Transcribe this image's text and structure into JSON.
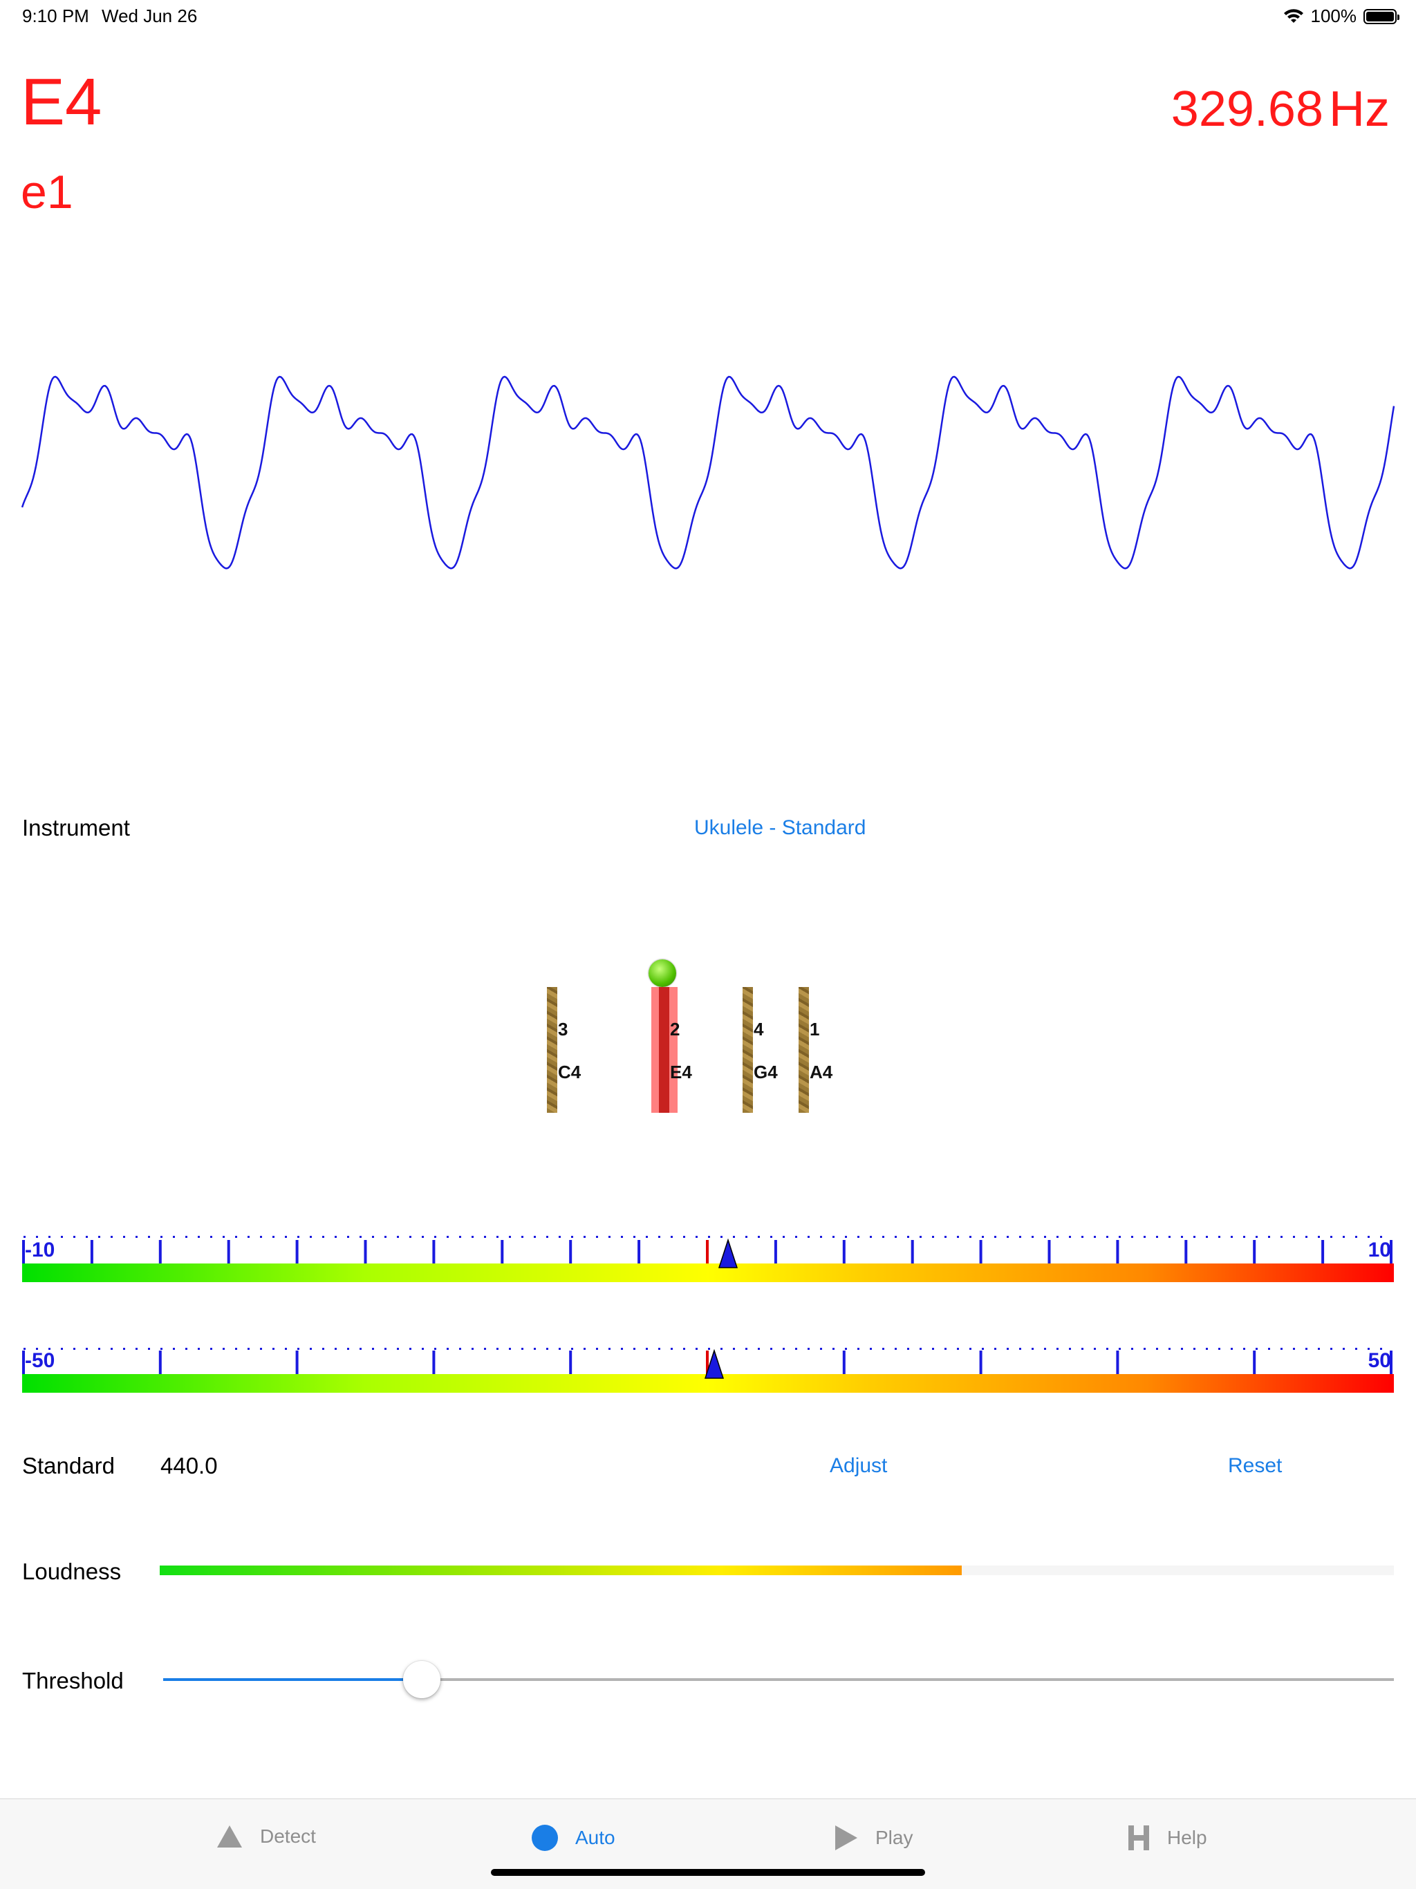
{
  "status_bar": {
    "time": "9:10 PM",
    "date": "Wed Jun 26",
    "battery": "100%"
  },
  "note": {
    "name": "E4",
    "alt_name": "e1"
  },
  "frequency": {
    "value": "329.68",
    "unit": "Hz"
  },
  "instrument": {
    "label": "Instrument",
    "value": "Ukulele - Standard"
  },
  "strings": [
    {
      "number": "3",
      "note": "C4",
      "active": false
    },
    {
      "number": "2",
      "note": "E4",
      "active": true
    },
    {
      "number": "4",
      "note": "G4",
      "active": false
    },
    {
      "number": "1",
      "note": "A4",
      "active": false
    }
  ],
  "fine_meter": {
    "min_label": "-10",
    "max_label": "10",
    "min": -10,
    "max": 10,
    "needle_value": 0.3,
    "target_value": 0
  },
  "coarse_meter": {
    "min_label": "-50",
    "max_label": "50",
    "min": -50,
    "max": 50,
    "needle_value": 0.5,
    "target_value": 0
  },
  "standard": {
    "label": "Standard",
    "value": "440.0",
    "adjust_label": "Adjust",
    "reset_label": "Reset"
  },
  "loudness": {
    "label": "Loudness",
    "level": 0.65
  },
  "threshold": {
    "label": "Threshold",
    "value": 0.21
  },
  "tabs": [
    {
      "label": "Detect",
      "icon": "triangle-icon",
      "active": false
    },
    {
      "label": "Auto",
      "icon": "circle-icon",
      "active": true
    },
    {
      "label": "Play",
      "icon": "play-icon",
      "active": false
    },
    {
      "label": "Help",
      "icon": "h-icon",
      "active": false
    }
  ],
  "colors": {
    "accent": "#1a7ee6",
    "note_red": "#ff1a1a",
    "waveform": "#1a1adf"
  }
}
